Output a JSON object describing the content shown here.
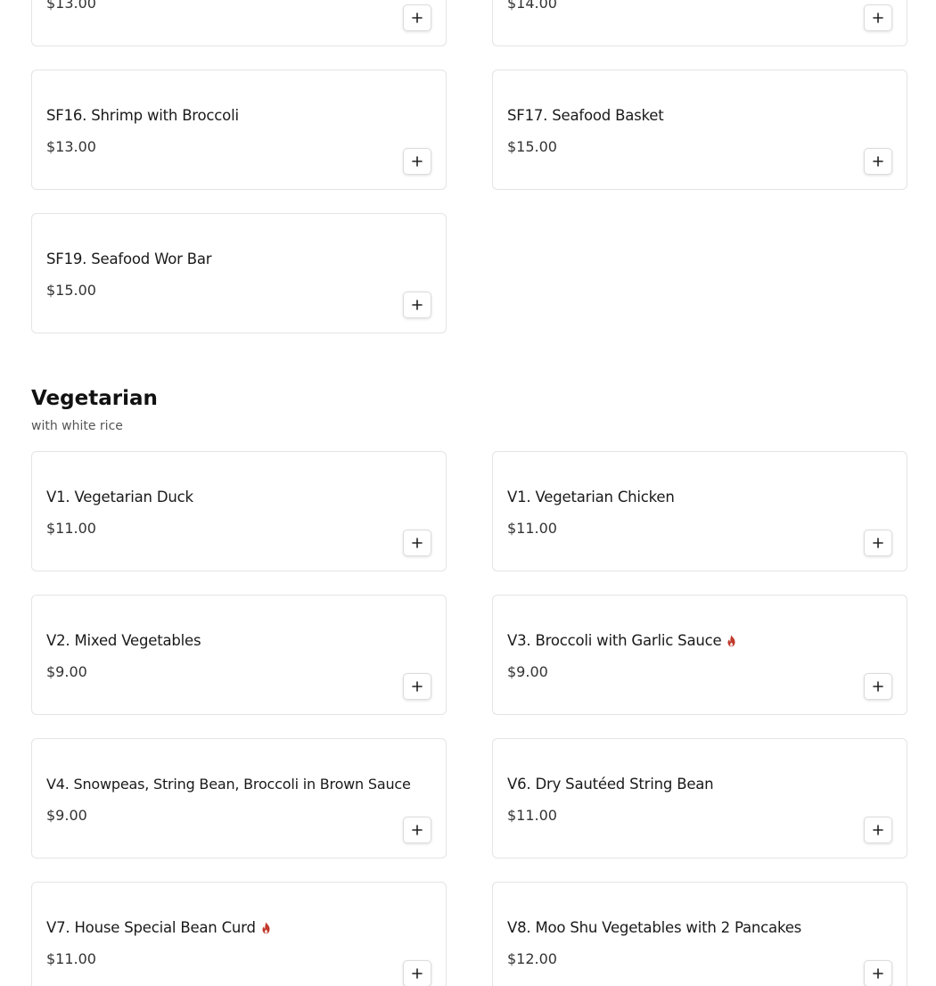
{
  "colors": {
    "spicy": "#c0392b",
    "border": "#e4e4e4"
  },
  "seafood": {
    "items": [
      {
        "name": "",
        "price": "$13.00"
      },
      {
        "name": "",
        "price": "$14.00"
      },
      {
        "name": "SF16. Shrimp with Broccoli",
        "price": "$13.00"
      },
      {
        "name": "SF17. Seafood Basket",
        "price": "$15.00"
      },
      {
        "name": "SF19. Seafood Wor Bar",
        "price": "$15.00"
      }
    ]
  },
  "vegetarian": {
    "title": "Vegetarian",
    "subtitle": "with white rice",
    "items": [
      {
        "name": "V1. Vegetarian Duck",
        "price": "$11.00",
        "spicy": false
      },
      {
        "name": "V1. Vegetarian Chicken",
        "price": "$11.00",
        "spicy": false
      },
      {
        "name": "V2. Mixed Vegetables",
        "price": "$9.00",
        "spicy": false
      },
      {
        "name": "V3. Broccoli with Garlic Sauce",
        "price": "$9.00",
        "spicy": true
      },
      {
        "name": "V4. Snowpeas, String Bean, Broccoli in Brown Sauce",
        "price": "$9.00",
        "spicy": false
      },
      {
        "name": "V6. Dry Sautéed String Bean",
        "price": "$11.00",
        "spicy": false
      },
      {
        "name": "V7. House Special Bean Curd",
        "price": "$11.00",
        "spicy": true
      },
      {
        "name": "V8. Moo Shu Vegetables with 2 Pancakes",
        "price": "$12.00",
        "spicy": false
      }
    ]
  },
  "icons": {
    "add": "plus-icon",
    "spicy": "flame-icon"
  }
}
